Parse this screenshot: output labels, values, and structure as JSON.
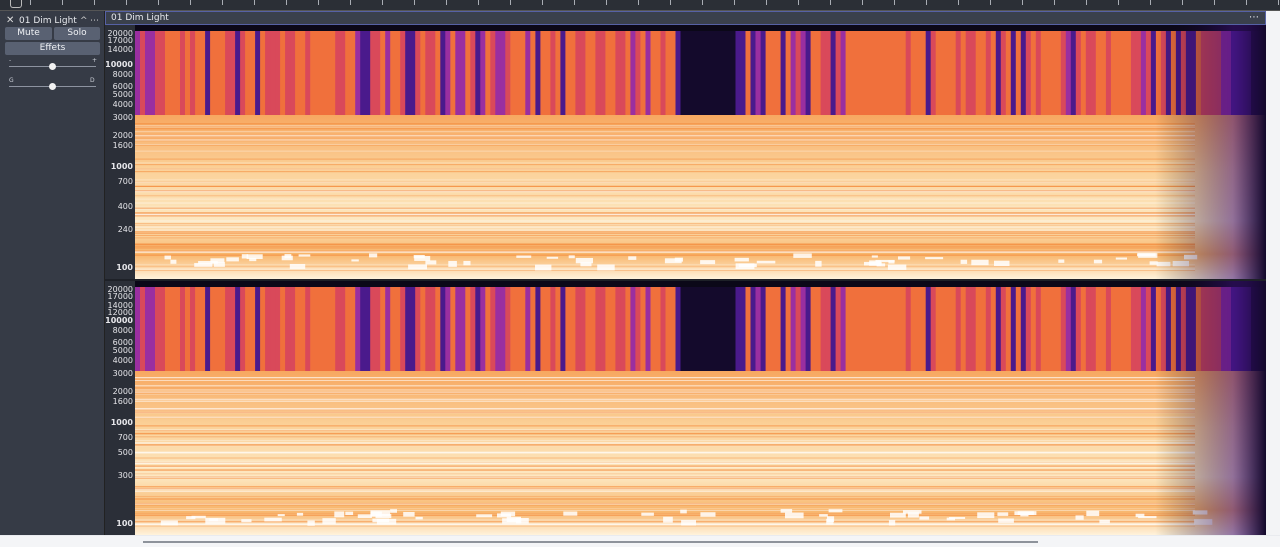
{
  "track": {
    "name": "01 Dim Light",
    "mute_label": "Mute",
    "solo_label": "Solo",
    "effects_label": "Effets",
    "volume_minus": "-",
    "volume_plus": "+",
    "pan_left": "G",
    "pan_right": "D",
    "volume_level": 0.5,
    "pan_level": 0.5
  },
  "spectrogram": {
    "title": "01 Dim Light",
    "view": "spectrogram",
    "scale": "logarithmic",
    "channels": 2,
    "axis_labels": [
      "20000",
      "17000",
      "14000",
      "12000",
      "10000",
      "8000",
      "6000",
      "5000",
      "4000",
      "3000",
      "2000",
      "1600",
      "1000",
      "700",
      "500",
      "400",
      "300",
      "240",
      "100"
    ],
    "channel1_labels": [
      "20000",
      "17000",
      "14000",
      "10000",
      "8000",
      "6000",
      "5000",
      "4000",
      "3000",
      "2000",
      "1600",
      "1000",
      "700",
      "400",
      "240",
      "100"
    ],
    "channel2_labels": [
      "20000",
      "17000",
      "14000",
      "12000",
      "10000",
      "8000",
      "6000",
      "5000",
      "4000",
      "3000",
      "2000",
      "1600",
      "1000",
      "700",
      "500",
      "300",
      "100"
    ],
    "bold_labels": [
      "10000",
      "1000",
      "100"
    ],
    "colors": {
      "background": "#1e2128",
      "high_energy": "#fff4d6",
      "mid_energy": "#f58d3a",
      "low_energy": "#6a1fa0",
      "silence": "#0a0716"
    }
  },
  "icons": {
    "close": "close-icon",
    "collapse": "chevron-up-icon",
    "menu": "more-icon",
    "panel_menu": "more-icon",
    "ruler": "cursor-icon"
  }
}
